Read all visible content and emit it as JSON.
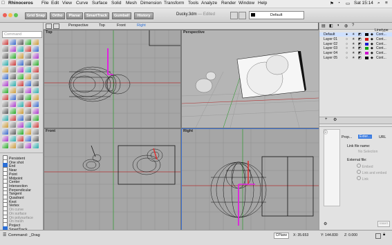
{
  "menubar": {
    "app": "Rhinoceros",
    "items": [
      "File",
      "Edit",
      "View",
      "Curve",
      "Surface",
      "Solid",
      "Mesh",
      "Dimension",
      "Transform",
      "Tools",
      "Analyze",
      "Render",
      "Window",
      "Help"
    ],
    "clock": "Sat 15:14"
  },
  "window": {
    "title": "Ducky.3dm",
    "title_status": "— Edited",
    "layer_display": "Default"
  },
  "toolbar": {
    "buttons": [
      "Grid Snap",
      "Ortho",
      "Planar",
      "SmartTrack",
      "Gumball",
      "History"
    ]
  },
  "command": {
    "placeholder": "Command"
  },
  "viewport_tabs": [
    "Perspective",
    "Top",
    "Front",
    "Right"
  ],
  "viewports": {
    "top": "Top",
    "perspective": "Perspective",
    "front": "Front",
    "right": "Right"
  },
  "osnaps": {
    "items": [
      {
        "label": "Persistent",
        "checked": false,
        "dim": false
      },
      {
        "label": "One shot",
        "checked": false,
        "dim": false
      },
      {
        "label": "End",
        "checked": true,
        "dim": false
      },
      {
        "label": "Near",
        "checked": false,
        "dim": false
      },
      {
        "label": "Point",
        "checked": false,
        "dim": false
      },
      {
        "label": "Midpoint",
        "checked": false,
        "dim": false
      },
      {
        "label": "Center",
        "checked": false,
        "dim": false
      },
      {
        "label": "Intersection",
        "checked": false,
        "dim": false
      },
      {
        "label": "Perpendicular",
        "checked": false,
        "dim": false
      },
      {
        "label": "Tangent",
        "checked": false,
        "dim": false
      },
      {
        "label": "Quadrant",
        "checked": false,
        "dim": false
      },
      {
        "label": "Knot",
        "checked": false,
        "dim": false
      },
      {
        "label": "Vertex",
        "checked": false,
        "dim": false
      },
      {
        "label": "On curve",
        "checked": false,
        "dim": true
      },
      {
        "label": "On surface",
        "checked": false,
        "dim": true
      },
      {
        "label": "On polysurface",
        "checked": false,
        "dim": true
      },
      {
        "label": "On mesh",
        "checked": false,
        "dim": true
      },
      {
        "label": "Project",
        "checked": false,
        "dim": false
      },
      {
        "label": "SmartTrack",
        "checked": true,
        "dim": false
      }
    ]
  },
  "layers": {
    "linetype_header": "Linetype",
    "rows": [
      {
        "name": "Default",
        "color": "#000000",
        "linetype": "Cont..."
      },
      {
        "name": "Layer 01",
        "color": "#d01010",
        "linetype": "Cont..."
      },
      {
        "name": "Layer 02",
        "color": "#1a1ad0",
        "linetype": "Cont..."
      },
      {
        "name": "Layer 03",
        "color": "#10a010",
        "linetype": "Cont..."
      },
      {
        "name": "Layer 04",
        "color": "#d010d0",
        "linetype": "Cont..."
      },
      {
        "name": "Layer 05",
        "color": "#000000",
        "linetype": "Cont..."
      }
    ]
  },
  "properties": {
    "tabs": [
      "Prop...",
      "Exter...",
      "URL"
    ],
    "link_label": "Link file name:",
    "link_value": "No Selection",
    "external_label": "External file:",
    "options": [
      "Embed",
      "Link and embed",
      "Link"
    ],
    "insert_button": "Insert"
  },
  "status": {
    "command_text": "Command: _Drag",
    "cplane": "CPlane",
    "x": "X: 35.653",
    "y": "Y: 144.830",
    "z": "Z: 0.000"
  }
}
